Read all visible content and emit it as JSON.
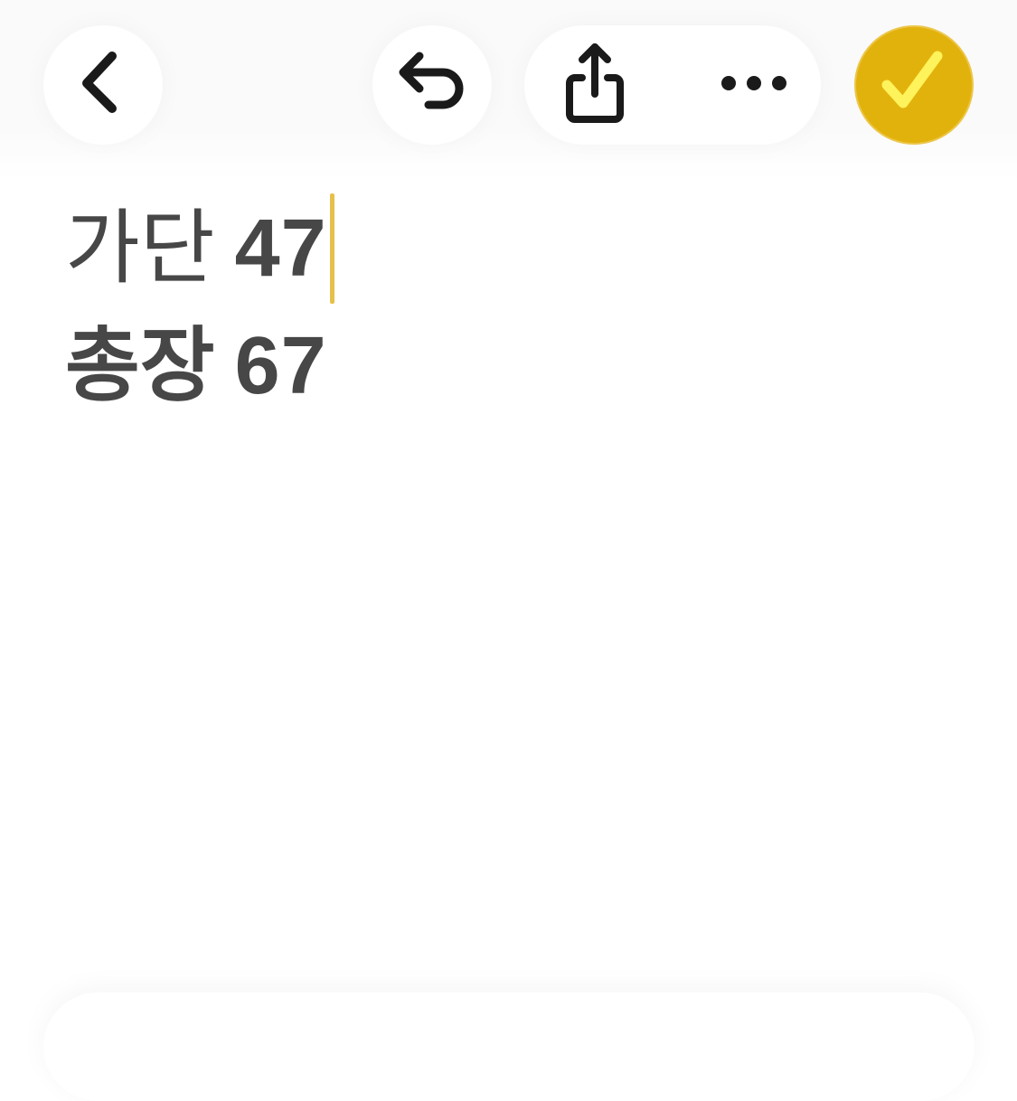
{
  "toolbar": {
    "back_icon": "chevron-left-icon",
    "undo_icon": "undo-icon",
    "share_icon": "share-icon",
    "more_icon": "ellipsis-icon",
    "done_icon": "checkmark-icon",
    "accent_color": "#e2b20c",
    "checkmark_color": "#fff35c"
  },
  "note": {
    "lines": [
      {
        "label": "가단",
        "value": "47"
      },
      {
        "label": "총장",
        "value": "67"
      }
    ],
    "text_color": "#474747",
    "caret_color": "#e6c04a"
  }
}
